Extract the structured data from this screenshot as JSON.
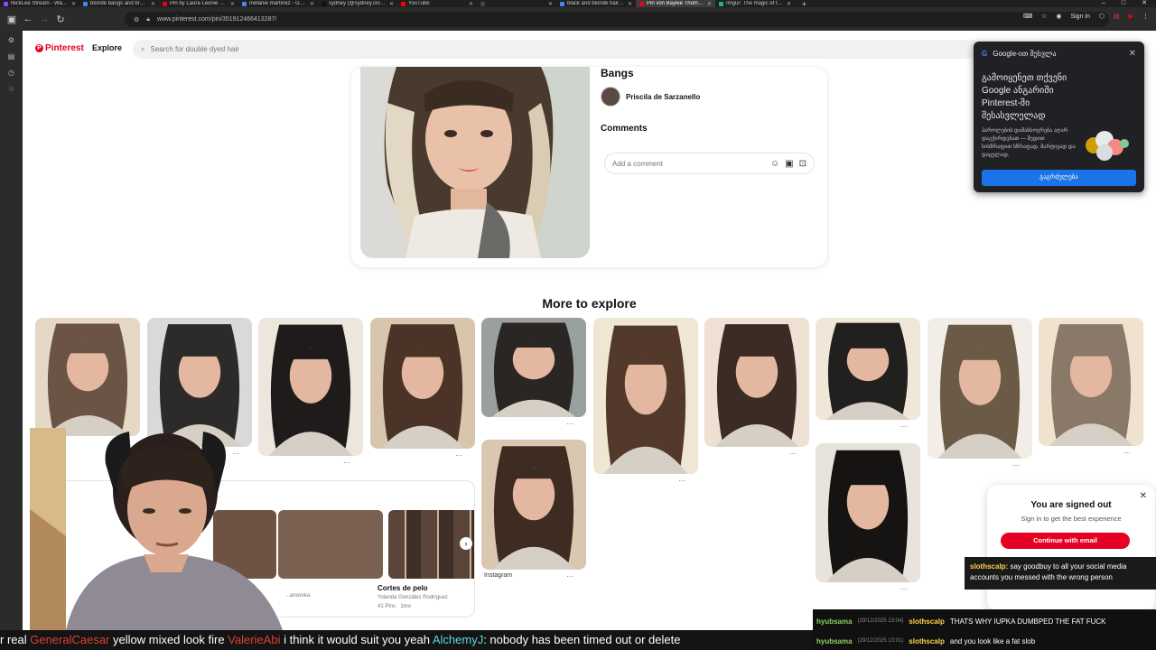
{
  "browser": {
    "tabs": [
      {
        "title": "NickLee Stream - Watch Live on",
        "color": "#9146ff"
      },
      {
        "title": "blonde bangs and brown hair -",
        "color": "#4285f4"
      },
      {
        "title": "Pin by Laura Leonie on hair styl",
        "color": "#e60023"
      },
      {
        "title": "melanie martinez - Google Sea",
        "color": "#4285f4"
      },
      {
        "title": "sydney (@sydney.clouse) | Tik",
        "color": "#111111"
      },
      {
        "title": "YouTube",
        "color": "#ff0000"
      },
      {
        "title": "",
        "color": "#444444"
      },
      {
        "title": "black and blonde hair - Google",
        "color": "#4285f4"
      },
      {
        "title": "Pin von Baylee Thomas-Poirier",
        "color": "#e60023",
        "active": true
      },
      {
        "title": "Imgur: The magic of the Intern",
        "color": "#1bb76e"
      }
    ],
    "new_tab": "+",
    "url": "www.pinterest.com/pin/351912466413287/",
    "sign_in": "Sign in"
  },
  "pinterest": {
    "logo": "Pinterest",
    "explore": "Explore",
    "search_placeholder": "Search for double dyed hair",
    "pin_title": "Bangs",
    "author": "Priscila de Sarzanello",
    "comments_label": "Comments",
    "comment_placeholder": "Add a comment",
    "more_to_explore": "More to explore",
    "board_item": {
      "title": "Cortes de pelo",
      "creator": "Yolanda González Rodríguez",
      "count": "41 Pins · 1mo"
    },
    "board_creator_left": "...anovska",
    "instagram": "Instagram",
    "more_dots": "···"
  },
  "google_popup": {
    "header": "Google-ით შესვლა",
    "title": "გამოიყენეთ თქვენი Google ანგარიში Pinterest-ში შესასვლელად",
    "body": "პაროლების დამახსოვრება აღარ დაგჭირდებათ — შედით სისწრაფით სწრაფად, მარტივად და დაცულად.",
    "button": "გაგრძელება"
  },
  "signed_out": {
    "title": "You are signed out",
    "subtitle": "Sign in to get the best experience",
    "button": "Continue with email"
  },
  "stream_chat": {
    "ticker": [
      {
        "text": "r real ",
        "type": "plain"
      },
      {
        "text": "GeneralCaesar",
        "type": "user"
      },
      {
        "text": " yellow mixed look fire ",
        "type": "plain"
      },
      {
        "text": "ValerieAbi",
        "type": "user"
      },
      {
        "text": " i think it would suit you yeah ",
        "type": "plain"
      },
      {
        "text": "AlchemyJ",
        "type": "user2"
      },
      {
        "text": ": nobody has been timed out or delete",
        "type": "plain"
      }
    ],
    "highlight_user": "slothscalp:",
    "highlight_msg": "say goodbuy to all your social media accounts you messed with the wrong person",
    "lines": [
      {
        "name": "hyubsama",
        "date": "(29/12/2025 13:04)",
        "sender": "slothscalp",
        "msg": "THATS WHY IUPKA DUMBPED THE FAT FUCK"
      },
      {
        "name": "hyubsama",
        "date": "(29/12/2025 13:01)",
        "sender": "slothscalp",
        "msg": "and you look like a fat slob"
      }
    ]
  }
}
